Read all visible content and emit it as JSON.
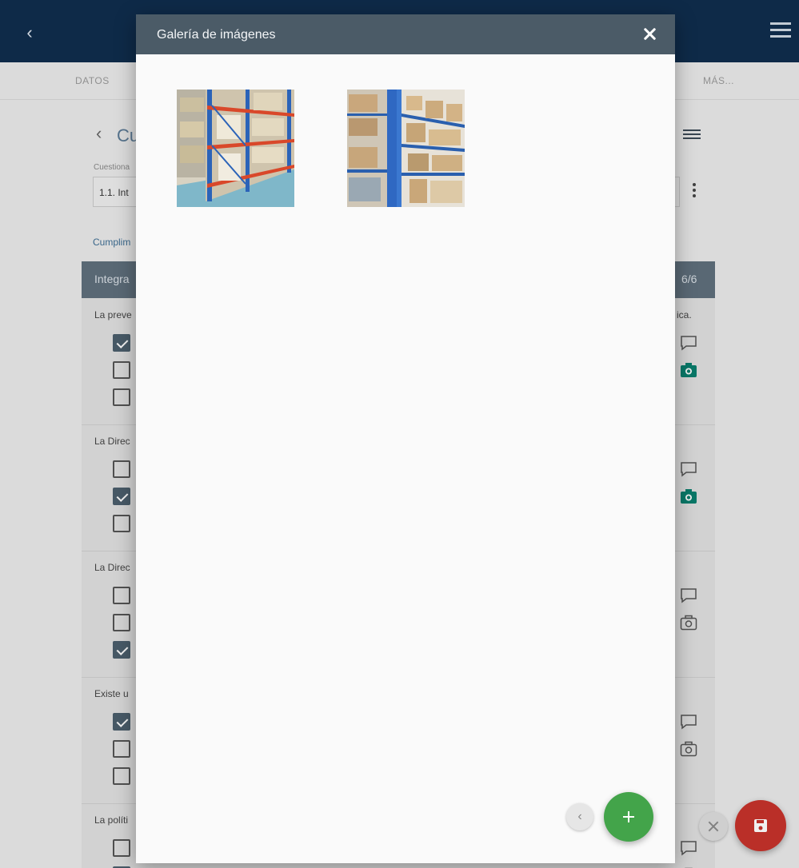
{
  "app": {
    "tabs": [
      "DATOS",
      "MÁS..."
    ],
    "section_title_fragment": "Cu",
    "field_label_fragment": "Cuestiona",
    "field_value_fragment": "1.1. Int",
    "link_fragment": "Cumplim",
    "panel_title_fragment": "Integra",
    "panel_count": "6/6",
    "questions": [
      {
        "text": "La preve",
        "trail": "ica.",
        "checks": [
          true,
          false,
          false
        ]
      },
      {
        "text": "La Direc",
        "trail": "",
        "checks": [
          false,
          true,
          false
        ]
      },
      {
        "text": "La Direc",
        "trail": "",
        "checks": [
          false,
          false,
          true
        ]
      },
      {
        "text": "Existe u",
        "trail": "",
        "checks": [
          true,
          false,
          false
        ]
      },
      {
        "text": "La políti",
        "trail": "",
        "checks": [
          false,
          true,
          false
        ]
      }
    ]
  },
  "dialog": {
    "title": "Galería de imágenes",
    "images": [
      {
        "icon": "warehouse-shelving-photo-1"
      },
      {
        "icon": "warehouse-shelving-photo-2"
      }
    ]
  },
  "colors": {
    "topbar": "#0f2d4d",
    "dialog_header": "#4b5b67",
    "add_button": "#43a44a",
    "save_button": "#c6322b",
    "camera_active": "#0a7f6e"
  }
}
